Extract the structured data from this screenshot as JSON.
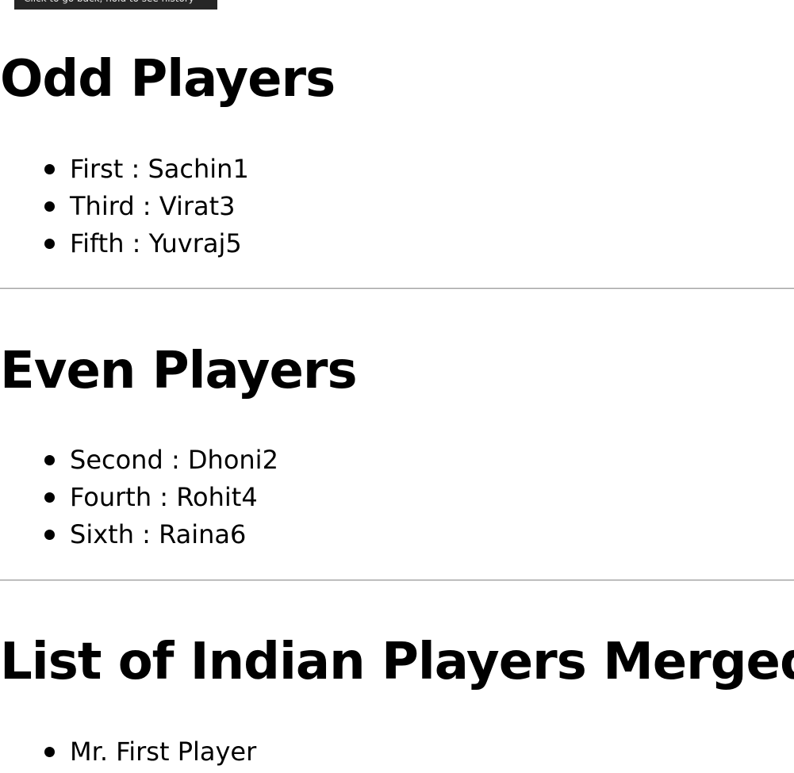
{
  "tooltip": {
    "text": "Click to go back, hold to see history"
  },
  "sections": [
    {
      "heading": "Odd Players",
      "items": [
        "First : Sachin1",
        "Third : Virat3",
        "Fifth : Yuvraj5"
      ]
    },
    {
      "heading": "Even Players",
      "items": [
        "Second : Dhoni2",
        "Fourth : Rohit4",
        "Sixth : Raina6"
      ]
    },
    {
      "heading": "List of Indian Players Merged:",
      "items": [
        "Mr. First Player"
      ]
    }
  ]
}
